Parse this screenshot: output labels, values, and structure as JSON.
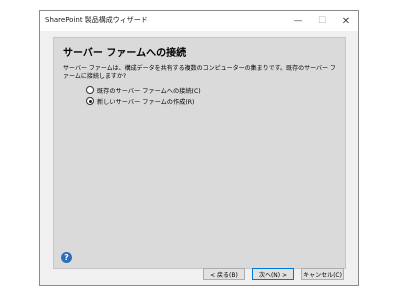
{
  "window": {
    "title": "SharePoint 製品構成ウィザード",
    "minimize": "—",
    "maximize": "☐",
    "close": "✕"
  },
  "page": {
    "heading": "サーバー ファームへの接続",
    "description": "サーバー ファームは、構成データを共有する複数のコンピューターの集まりです。既存のサーバー ファームに接続しますか?",
    "options": [
      {
        "label": "既存のサーバー ファームへの接続(C)",
        "checked": false
      },
      {
        "label": "新しいサーバー ファームの作成(R)",
        "checked": true
      }
    ]
  },
  "help": {
    "icon": "?"
  },
  "buttons": {
    "back": "< 戻る(B)",
    "next": "次へ(N) >",
    "cancel": "キャンセル(C)"
  }
}
